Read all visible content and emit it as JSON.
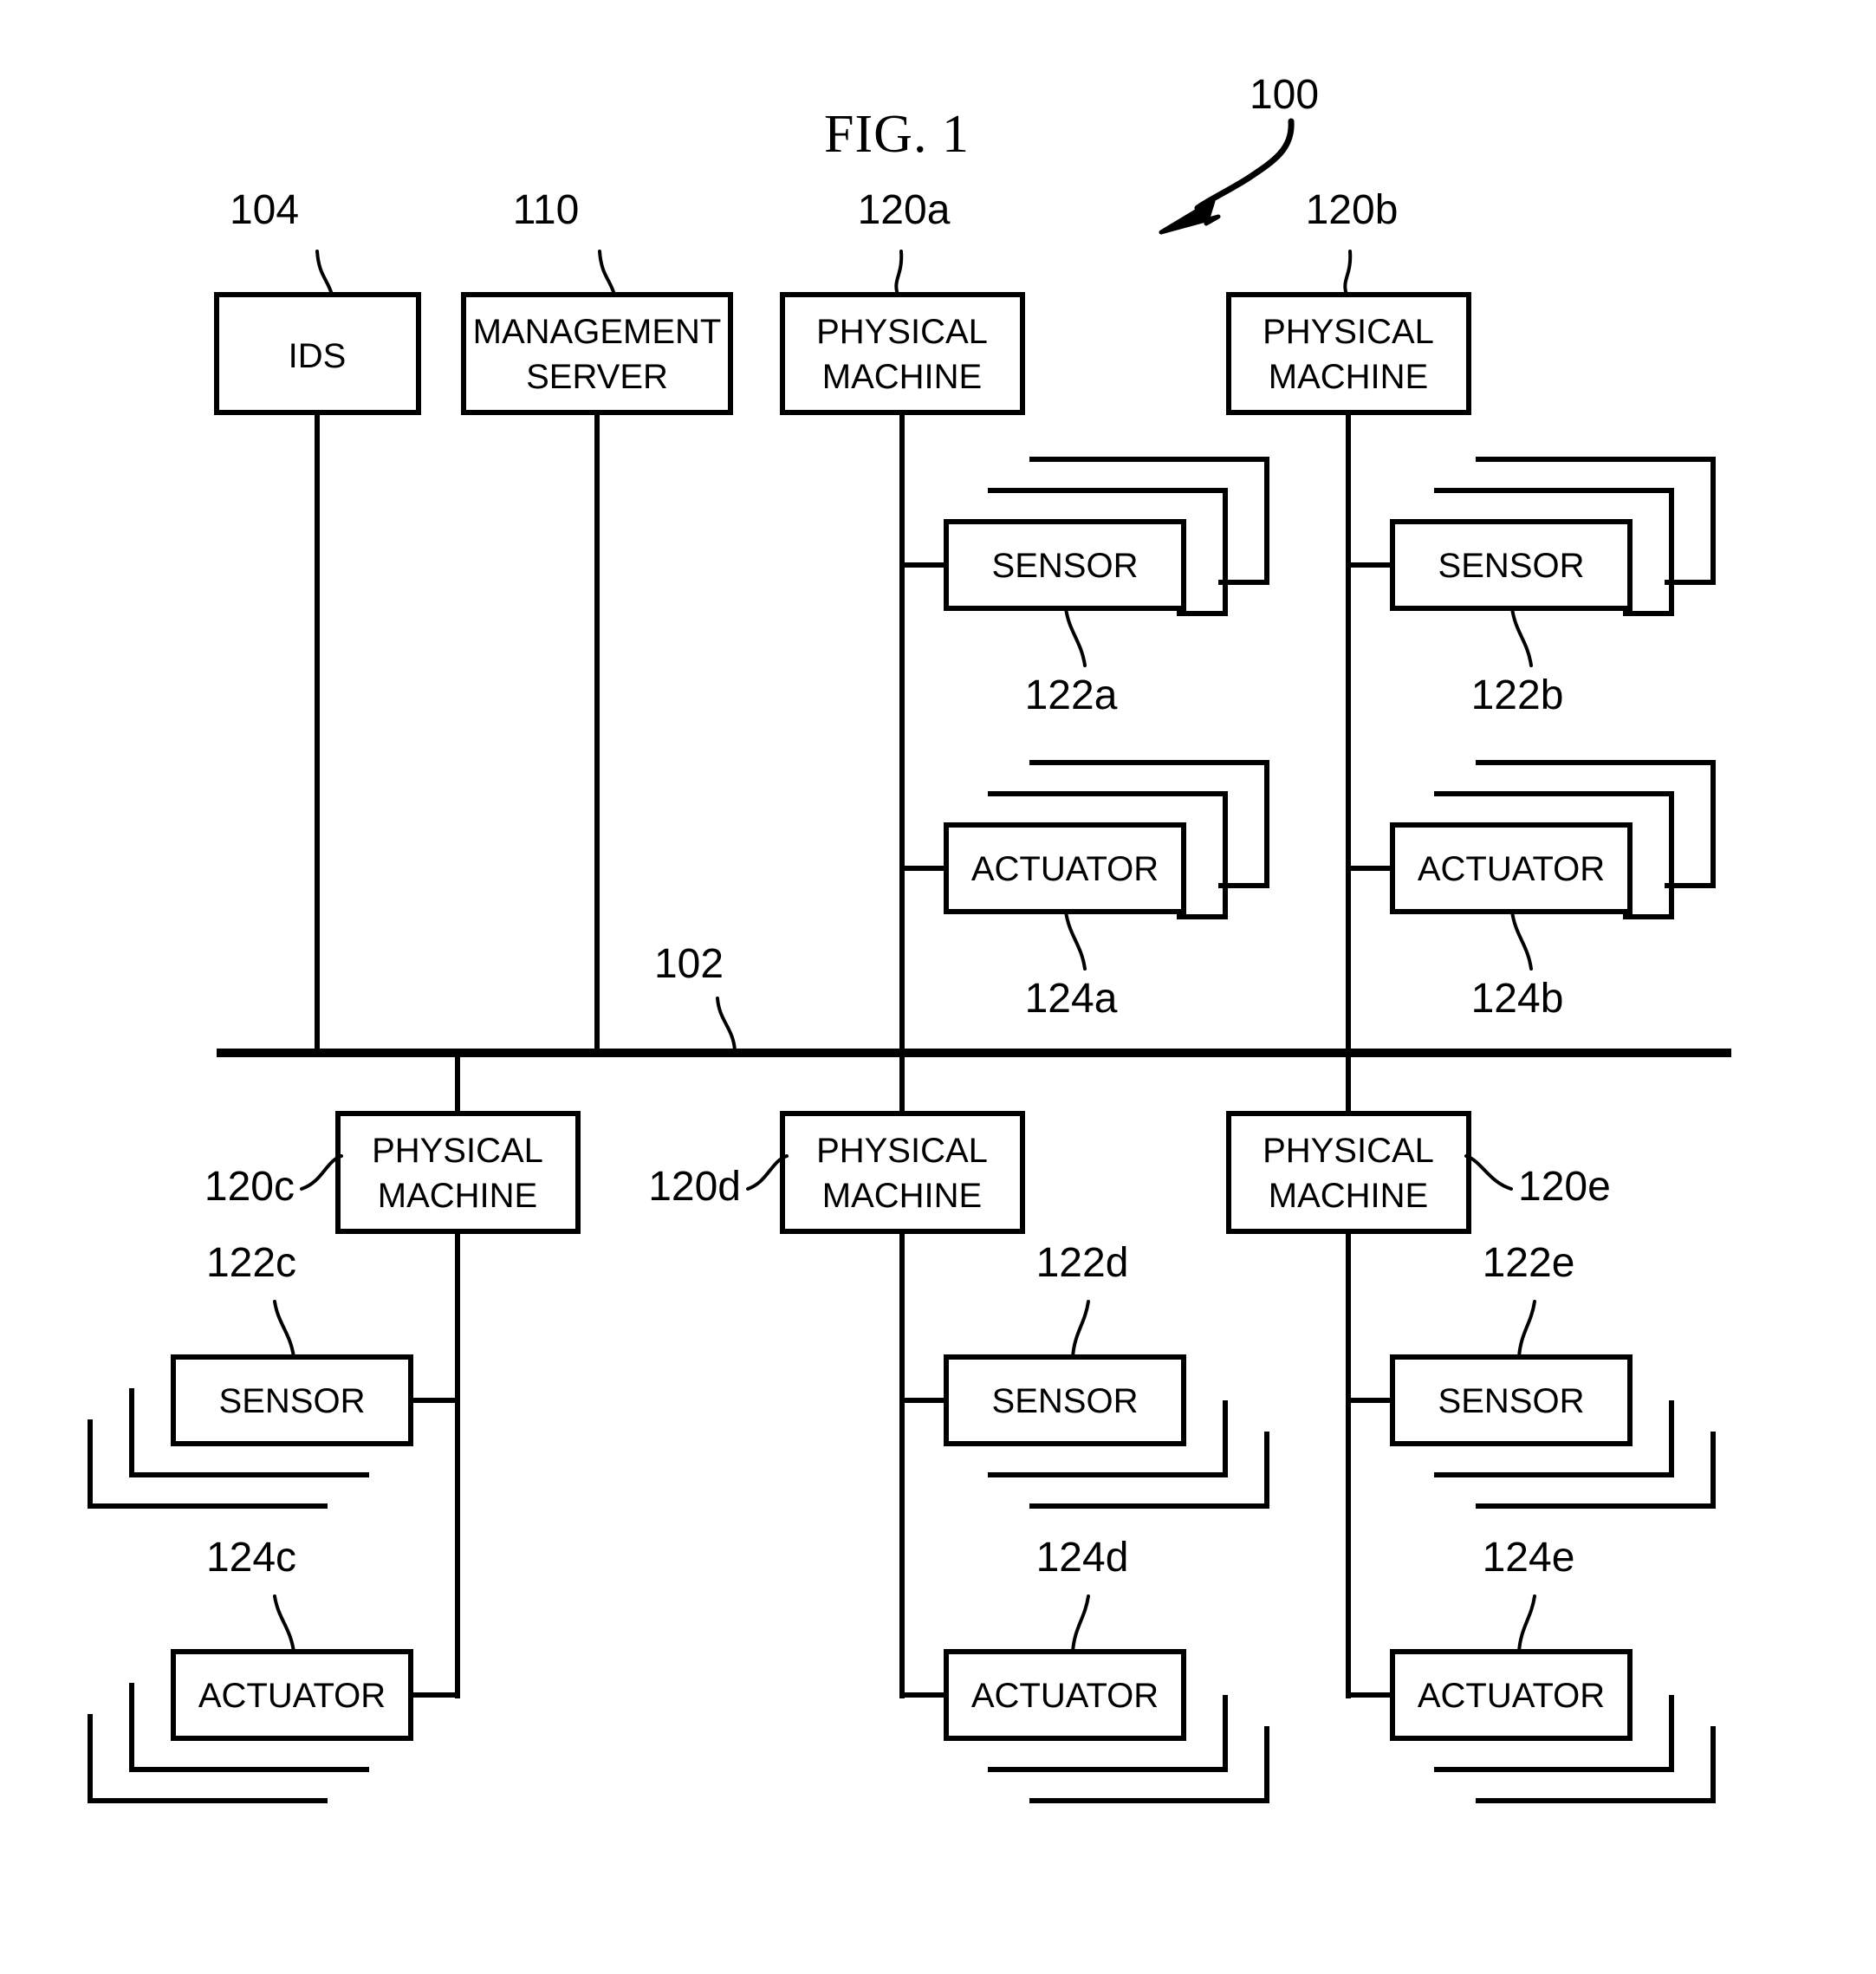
{
  "figure": {
    "title": "FIG. 1",
    "system_ref": "100",
    "bus_ref": "102",
    "bus_description": "network bus"
  },
  "top_row": [
    {
      "ref": "104",
      "label_line1": "IDS",
      "label_line2": "",
      "name": "ids"
    },
    {
      "ref": "110",
      "label_line1": "MANAGEMENT",
      "label_line2": "SERVER",
      "name": "management-server"
    },
    {
      "ref": "120a",
      "label_line1": "PHYSICAL",
      "label_line2": "MACHINE",
      "name": "physical-machine-a"
    },
    {
      "ref": "120b",
      "label_line1": "PHYSICAL",
      "label_line2": "MACHINE",
      "name": "physical-machine-b"
    }
  ],
  "bottom_row": [
    {
      "ref": "120c",
      "label_line1": "PHYSICAL",
      "label_line2": "MACHINE",
      "name": "physical-machine-c"
    },
    {
      "ref": "120d",
      "label_line1": "PHYSICAL",
      "label_line2": "MACHINE",
      "name": "physical-machine-d"
    },
    {
      "ref": "120e",
      "label_line1": "PHYSICAL",
      "label_line2": "MACHINE",
      "name": "physical-machine-e"
    }
  ],
  "devices": {
    "sensor_label": "SENSOR",
    "actuator_label": "ACTUATOR",
    "stack_depth": 3,
    "sensors": [
      {
        "ref": "122a",
        "parent": "120a"
      },
      {
        "ref": "122b",
        "parent": "120b"
      },
      {
        "ref": "122c",
        "parent": "120c"
      },
      {
        "ref": "122d",
        "parent": "120d"
      },
      {
        "ref": "122e",
        "parent": "120e"
      }
    ],
    "actuators": [
      {
        "ref": "124a",
        "parent": "120a"
      },
      {
        "ref": "124b",
        "parent": "120b"
      },
      {
        "ref": "124c",
        "parent": "120c"
      },
      {
        "ref": "124d",
        "parent": "120d"
      },
      {
        "ref": "124e",
        "parent": "120e"
      }
    ]
  },
  "colors": {
    "ink": "#000000",
    "paper": "#ffffff"
  }
}
